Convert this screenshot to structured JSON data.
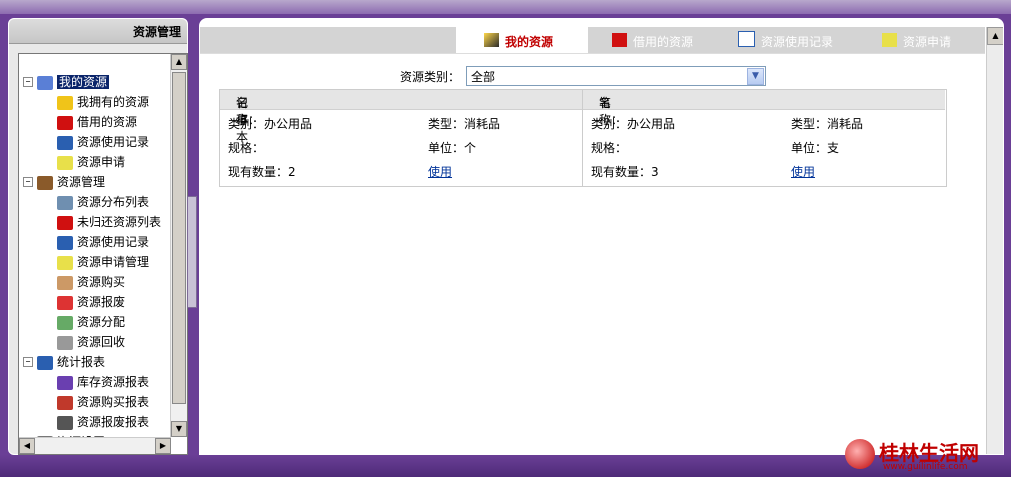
{
  "sidebar": {
    "title": "资源管理",
    "tree": [
      {
        "label": "我的资源",
        "level": 0,
        "expander": "−",
        "icon": "user-resources-icon",
        "selected": true
      },
      {
        "label": "我拥有的资源",
        "level": 1,
        "icon": "owned-resource-icon"
      },
      {
        "label": "借用的资源",
        "level": 1,
        "icon": "borrowed-resource-icon"
      },
      {
        "label": "资源使用记录",
        "level": 1,
        "icon": "usage-record-icon"
      },
      {
        "label": "资源申请",
        "level": 1,
        "icon": "resource-request-icon"
      },
      {
        "label": "资源管理",
        "level": 0,
        "expander": "−",
        "icon": "resource-management-icon"
      },
      {
        "label": "资源分布列表",
        "level": 1,
        "icon": "distribution-list-icon"
      },
      {
        "label": "未归还资源列表",
        "level": 1,
        "icon": "unreturned-list-icon"
      },
      {
        "label": "资源使用记录",
        "level": 1,
        "icon": "usage-record-icon"
      },
      {
        "label": "资源申请管理",
        "level": 1,
        "icon": "request-management-icon"
      },
      {
        "label": "资源购买",
        "level": 1,
        "icon": "purchase-icon"
      },
      {
        "label": "资源报废",
        "level": 1,
        "icon": "scrap-icon"
      },
      {
        "label": "资源分配",
        "level": 1,
        "icon": "allocate-icon"
      },
      {
        "label": "资源回收",
        "level": 1,
        "icon": "recycle-icon"
      },
      {
        "label": "统计报表",
        "level": 0,
        "expander": "−",
        "icon": "report-icon"
      },
      {
        "label": "库存资源报表",
        "level": 1,
        "icon": "inventory-report-icon"
      },
      {
        "label": "资源购买报表",
        "level": 1,
        "icon": "purchase-report-icon"
      },
      {
        "label": "资源报废报表",
        "level": 1,
        "icon": "scrap-report-icon"
      },
      {
        "label": "资源设置",
        "level": 0,
        "expander": "+",
        "icon": "settings-icon"
      }
    ]
  },
  "tabs": [
    {
      "label": "我的资源",
      "active": true,
      "icon": "user-resources-icon"
    },
    {
      "label": "借用的资源",
      "active": false,
      "icon": "borrowed-resource-icon"
    },
    {
      "label": "资源使用记录",
      "active": false,
      "icon": "usage-record-icon"
    },
    {
      "label": "资源申请",
      "active": false,
      "icon": "resource-request-icon"
    }
  ],
  "filter": {
    "label": "资源类别：",
    "selected": "全部"
  },
  "resources": [
    {
      "name_label": "名称：",
      "name": "记事本",
      "category_label": "类别：",
      "category": "办公用品",
      "type_label": "类型：",
      "type": "消耗品",
      "spec_label": "规格：",
      "spec": "",
      "unit_label": "单位：",
      "unit": "个",
      "qty_label": "现有数量：",
      "qty": "2",
      "action": "使用"
    },
    {
      "name_label": "名称：",
      "name": "笔",
      "category_label": "类别：",
      "category": "办公用品",
      "type_label": "类型：",
      "type": "消耗品",
      "spec_label": "规格：",
      "spec": "",
      "unit_label": "单位：",
      "unit": "支",
      "qty_label": "现有数量：",
      "qty": "3",
      "action": "使用"
    }
  ],
  "watermark": {
    "text": "桂林生活网",
    "url": "www.guilinlife.com"
  }
}
